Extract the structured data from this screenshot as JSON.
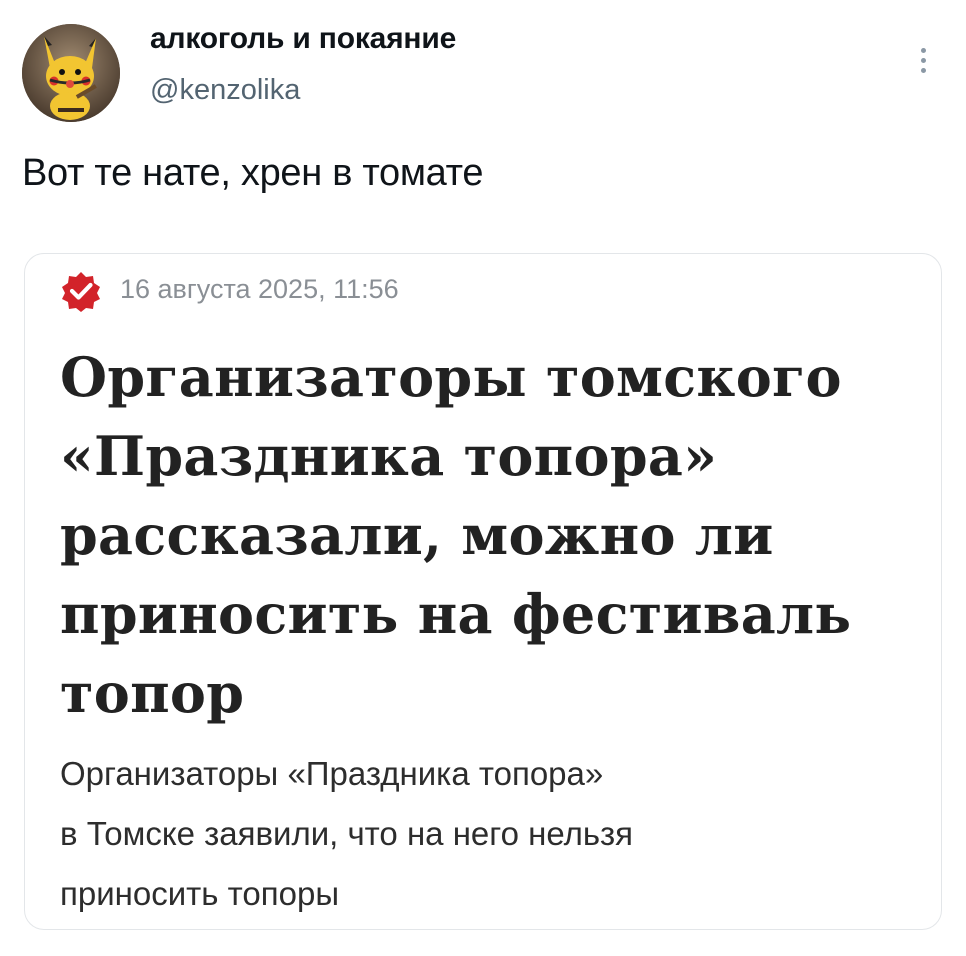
{
  "author": {
    "display_name": "алкоголь и покаяние",
    "handle": "@kenzolika"
  },
  "tweet": {
    "text": "Вот те нате, хрен в томате"
  },
  "quoted_card": {
    "source_icon": "red-badge-checkmark-icon",
    "date": "16 августа 2025, 11:56",
    "headline_lines": [
      "Организаторы томского",
      "«Праздника топора»",
      "рассказали, можно ли",
      "приносить на фестиваль",
      "топор"
    ],
    "subtitle_lines": [
      "Организаторы «Праздника топора»",
      "в Томске заявили, что на него нельзя",
      "приносить топоры"
    ]
  },
  "icons": {
    "more": "vertical-ellipsis-icon"
  },
  "colors": {
    "text_primary": "#0f1419",
    "text_secondary": "#536471",
    "card_border": "#e3e6e9",
    "badge_red": "#d2232a",
    "headline": "#222222",
    "date": "#8a8f95"
  }
}
